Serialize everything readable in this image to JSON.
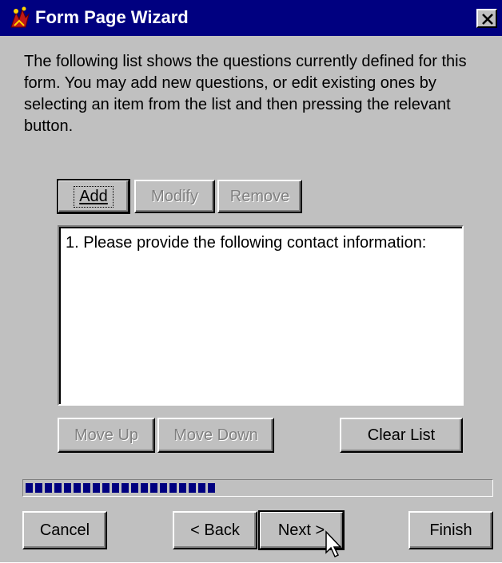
{
  "window": {
    "title": "Form Page Wizard",
    "app_icon": "form-page-wizard-app-icon",
    "close_icon": "close-icon",
    "colors": {
      "titlebar": "#000080",
      "face": "#c0c0c0",
      "progress": "#000080"
    }
  },
  "description": "The following list shows the questions currently defined for this form. You may add new questions, or edit existing ones by selecting an item from the list and then pressing the relevant button.",
  "list_buttons": {
    "add": {
      "label": "Add",
      "enabled": true
    },
    "modify": {
      "label": "Modify",
      "enabled": false
    },
    "remove": {
      "label": "Remove",
      "enabled": false
    }
  },
  "questions": [
    {
      "label": "1. Please provide the following contact information:"
    }
  ],
  "order_buttons": {
    "move_up": {
      "label": "Move Up",
      "enabled": false
    },
    "move_down": {
      "label": "Move Down",
      "enabled": false
    },
    "clear_list": {
      "label": "Clear List",
      "enabled": true
    }
  },
  "progress": {
    "fraction": 0.41,
    "blocks_filled": 20
  },
  "footer": {
    "cancel": "Cancel",
    "back": "< Back",
    "next": "Next >",
    "finish": "Finish"
  }
}
